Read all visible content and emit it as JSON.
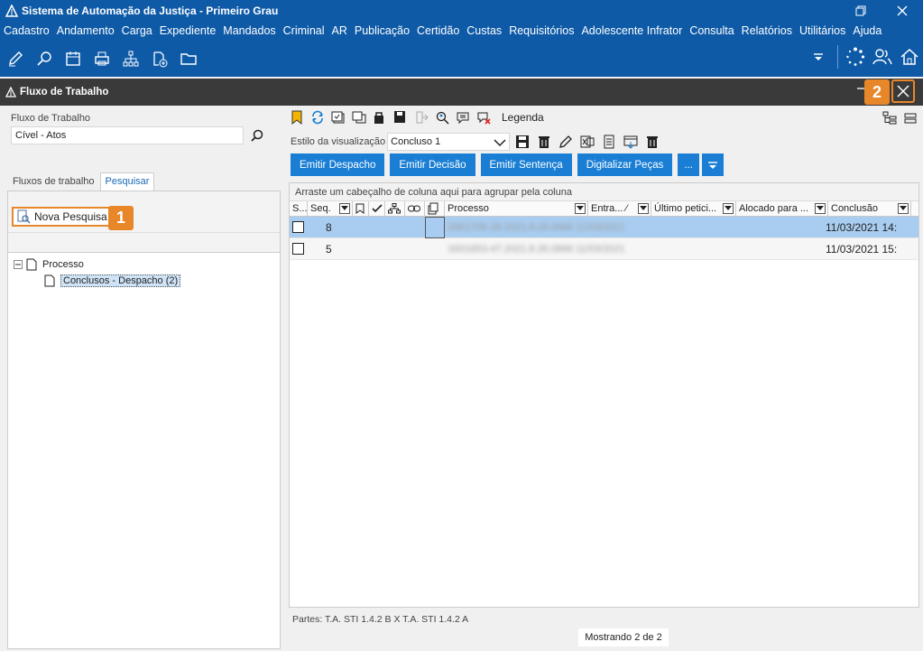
{
  "app": {
    "title": "Sistema de Automação da Justiça - Primeiro Grau"
  },
  "menu": [
    "Cadastro",
    "Andamento",
    "Carga",
    "Expediente",
    "Mandados",
    "Criminal",
    "AR",
    "Publicação",
    "Certidão",
    "Custas",
    "Requisitórios",
    "Adolescente Infrator",
    "Consulta",
    "Relatórios",
    "Utilitários",
    "Ajuda"
  ],
  "toolbar": {
    "icons": [
      "edit-icon",
      "search-process-icon",
      "calendar-icon",
      "printer-icon",
      "hierarchy-icon",
      "add-document-icon",
      "folder-icon"
    ],
    "right_icons": [
      "dropdown-arrow-icon",
      "loading-icon",
      "users-icon",
      "home-icon"
    ]
  },
  "child_window": {
    "title": "Fluxo de Trabalho"
  },
  "left": {
    "fluxo_label": "Fluxo de Trabalho",
    "fluxo_value": "Cível - Atos",
    "tabs": [
      "Fluxos de trabalho",
      "Pesquisar"
    ],
    "nova_pesquisa": "Nova Pesquisa",
    "tree": {
      "root": "Processo",
      "child": "Conclusos - Despacho (2)"
    }
  },
  "right": {
    "legend": "Legenda",
    "estilo_label": "Estilo da visualização",
    "estilo_value": "Concluso 1",
    "actions": [
      "Emitir Despacho",
      "Emitir Decisão",
      "Emitir Sentença",
      "Digitalizar Peças",
      "..."
    ],
    "grid_hint": "Arraste um cabeçalho de coluna aqui para agrupar pela coluna",
    "columns": [
      "S...",
      "Seq.",
      "",
      "",
      "",
      "",
      "",
      "Processo",
      "Entra... ⁄",
      "Último petici...",
      "Alocado para ...",
      "Conclusão"
    ],
    "rows": [
      {
        "seq": "8",
        "processo": "0001706-28.2021.8.26.0666 11/03/2021",
        "conclusao": "11/03/2021 14:",
        "selected": true
      },
      {
        "seq": "5",
        "processo": "0001653-47.2021.8.26.0666 11/03/2021",
        "conclusao": "11/03/2021 15:",
        "selected": false
      }
    ],
    "partes": "Partes: T.A. STI 1.4.2 B  X  T.A. STI 1.4.2 A",
    "status": "Mostrando 2 de 2"
  },
  "badges": [
    "1",
    "2"
  ],
  "colors": {
    "blue": "#0e5aa7",
    "accent": "#e8862a",
    "button": "#1a7fd4"
  }
}
